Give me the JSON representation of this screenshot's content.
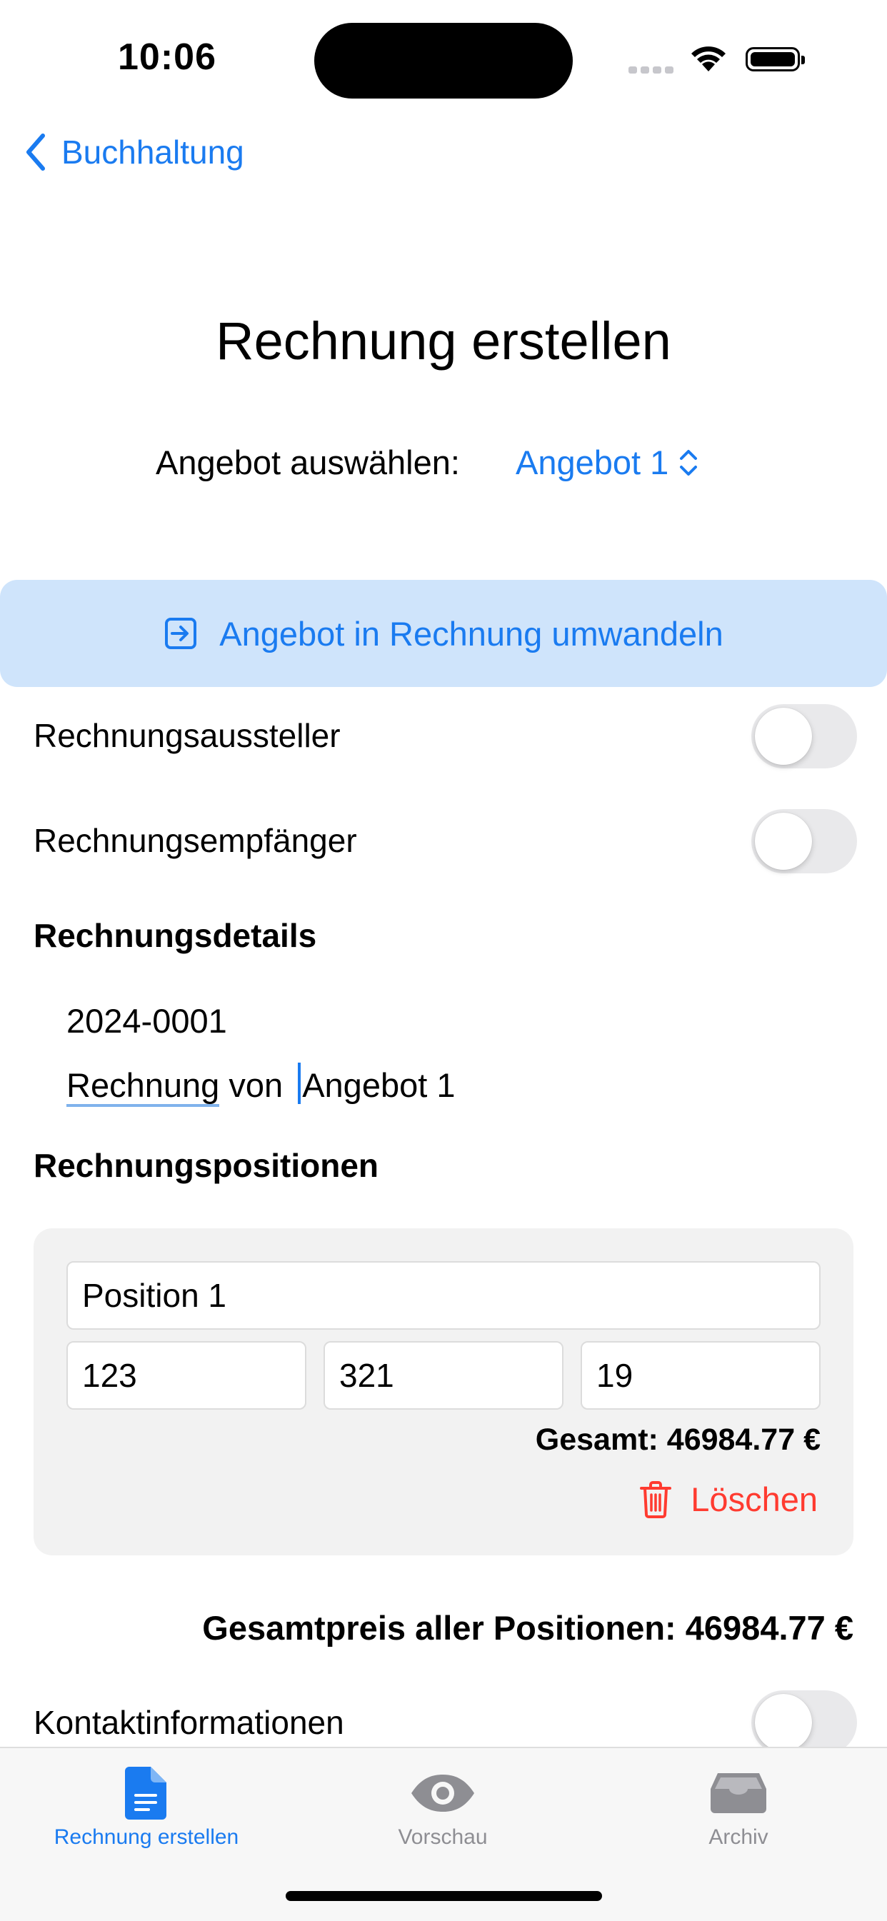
{
  "status": {
    "time": "10:06"
  },
  "nav": {
    "back_label": "Buchhaltung"
  },
  "page": {
    "title": "Rechnung erstellen"
  },
  "offer_picker": {
    "label": "Angebot auswählen:",
    "value": "Angebot 1"
  },
  "convert_button": {
    "label": "Angebot in Rechnung umwandeln"
  },
  "toggles": {
    "issuer": {
      "label": "Rechnungsaussteller",
      "on": false
    },
    "recipient": {
      "label": "Rechnungsempfänger",
      "on": false
    },
    "contact": {
      "label": "Kontaktinformationen",
      "on": false
    }
  },
  "details": {
    "heading": "Rechnungsdetails",
    "number": "2024-0001",
    "subject_word1": "Rechnung",
    "subject_word2": " von ",
    "subject_word3": "Angebot 1"
  },
  "positions": {
    "heading": "Rechnungspositionen",
    "items": [
      {
        "name": "Position 1",
        "quantity": "123",
        "price": "321",
        "tax": "19",
        "total_label": "Gesamt: 46984.77 €",
        "delete_label": "Löschen"
      }
    ],
    "grand_total_label": "Gesamtpreis aller Positionen: 46984.77 €"
  },
  "tabs": [
    {
      "label": "Rechnung erstellen",
      "icon": "document-icon",
      "active": true
    },
    {
      "label": "Vorschau",
      "icon": "eye-icon",
      "active": false
    },
    {
      "label": "Archiv",
      "icon": "archive-box-icon",
      "active": false
    }
  ],
  "colors": {
    "accent": "#1a7bf0",
    "destructive": "#ff3b30",
    "button_bg": "#cfe4fb"
  }
}
